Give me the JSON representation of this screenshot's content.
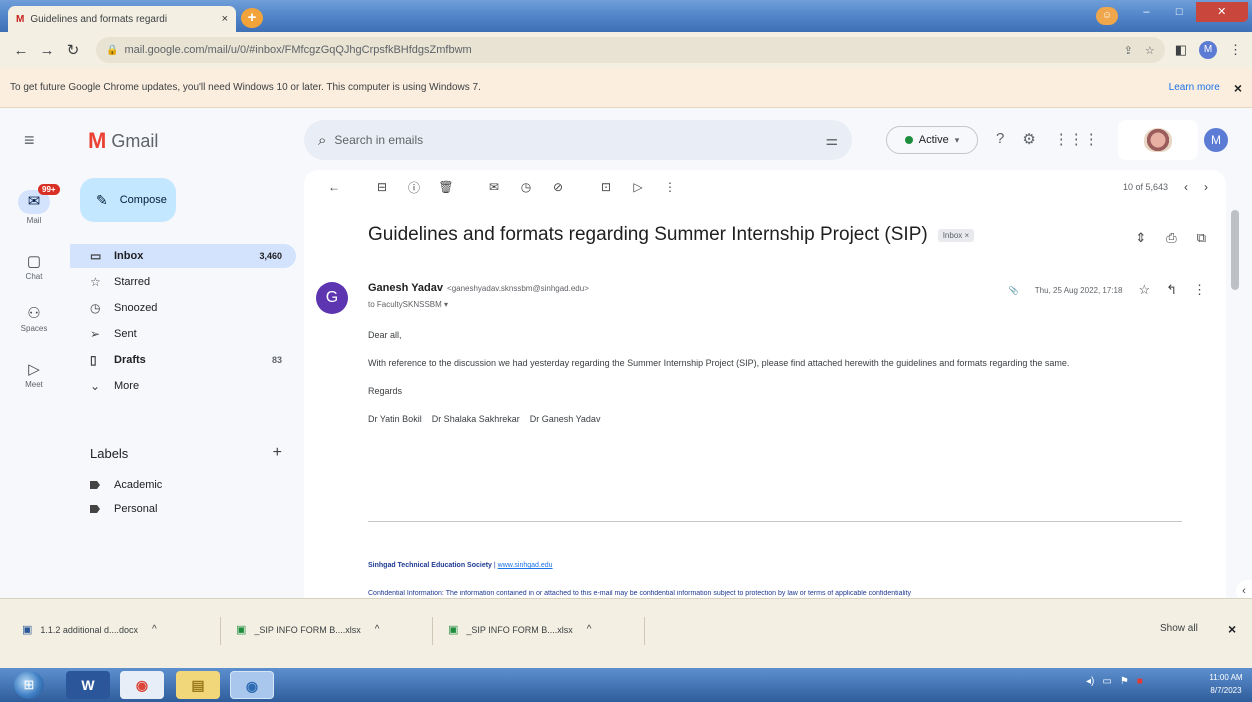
{
  "browser": {
    "tab_title": "Guidelines and formats regardi",
    "tab_favicon": "M",
    "tab_close": "×",
    "new_tab": "+",
    "url": "mail.google.com/mail/u/0/#inbox/FMfcgzGqQJhgCrpsfkBHfdgsZmfbwm",
    "infobar_message": "To get future Google Chrome updates, you'll need Windows 10 or later. This computer is using Windows 7.",
    "infobar_link": "Learn more",
    "infobar_close": "×",
    "profile_initial": "M"
  },
  "gmail": {
    "logo_text": "Gmail",
    "search_placeholder": "Search in emails",
    "status": "Active",
    "avatar_initial": "M"
  },
  "rail": {
    "mail_label": "Mail",
    "mail_badge": "99+",
    "chat_label": "Chat",
    "spaces_label": "Spaces",
    "meet_label": "Meet"
  },
  "sidebar": {
    "compose": "Compose",
    "items": [
      {
        "label": "Inbox",
        "count": "3,460",
        "icon": "inbox-icon"
      },
      {
        "label": "Starred",
        "count": "",
        "icon": "star-icon"
      },
      {
        "label": "Snoozed",
        "count": "",
        "icon": "clock-icon"
      },
      {
        "label": "Sent",
        "count": "",
        "icon": "send-icon"
      },
      {
        "label": "Drafts",
        "count": "83",
        "icon": "draft-icon"
      },
      {
        "label": "More",
        "count": "",
        "icon": "chevron-down-icon"
      }
    ],
    "labels_heading": "Labels",
    "labels": [
      {
        "label": "Academic"
      },
      {
        "label": "Personal"
      }
    ]
  },
  "message": {
    "pager": "10 of 5,643",
    "subject": "Guidelines and formats regarding Summer Internship Project (SIP)",
    "chip": "Inbox ×",
    "sender_initial": "G",
    "sender_name": "Ganesh Yadav",
    "sender_email": "<ganeshyadav.sknssbm@sinhgad.edu>",
    "to": "to FacultySKNSSBM ▾",
    "date": "Thu, 25 Aug 2022, 17:18",
    "greeting": "Dear all,",
    "body_para": "With reference to the discussion we had yesterday regarding the Summer Internship Project (SIP), please find attached herewith the guidelines and formats regarding the same.",
    "regards": "Regards",
    "signatories": "Dr Yatin Bokil    Dr Shalaka Sakhrekar    Dr Ganesh Yadav",
    "sig_org": "Sinhgad Technical Education Society",
    "sig_sep": " | ",
    "sig_link": "www.sinhgad.edu",
    "disclaimer": "Confidential Information: The information contained in or attached to this e-mail may be confidential information subject to protection by law or terms of applicable confidentiality"
  },
  "downloads": {
    "items": [
      {
        "name": "1.1.2 additional d....docx"
      },
      {
        "name": "_SIP INFO FORM B....xlsx"
      },
      {
        "name": "_SIP INFO FORM B....xlsx"
      }
    ],
    "show_all": "Show all",
    "close": "×"
  },
  "taskbar": {
    "time": "11:00 AM",
    "date": "8/7/2023"
  }
}
